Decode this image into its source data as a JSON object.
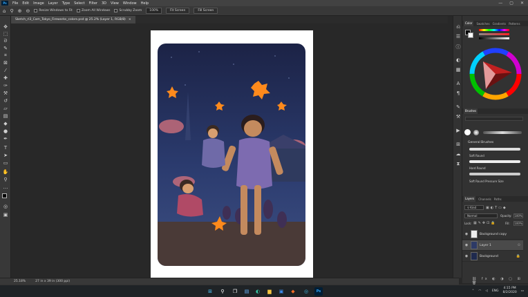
{
  "menubar": {
    "app_badge": "Ps",
    "items": [
      "File",
      "Edit",
      "Image",
      "Layer",
      "Type",
      "Select",
      "Filter",
      "3D",
      "View",
      "Window",
      "Help"
    ]
  },
  "options_bar": {
    "resize_windows_label": "Resize Windows to Fit",
    "zoom_all_label": "Zoom All Windows",
    "scrubby_zoom_label": "Scrubby Zoom",
    "zoom_value": "100%",
    "fit_screen_label": "Fit Screen",
    "fill_screen_label": "Fill Screen"
  },
  "document": {
    "tab_title": "Sketch_rl3_Cam_Tokyo_Fireworks_colors.psd @ 25.2% (Layer 1, RGB/8)",
    "close_glyph": "×"
  },
  "status_bar": {
    "zoom": "25.18%",
    "doc_size": "27 in x 39 in (300 ppi)"
  },
  "panels": {
    "color_tabs": [
      "Color",
      "Swatches",
      "Gradients",
      "Patterns"
    ],
    "brushes_tab": "Brushes",
    "brushes_group": "General Brushes",
    "brushes": [
      "Soft Round",
      "Hard Round",
      "Soft Round Pressure Size"
    ],
    "layers_tabs": [
      "Layers",
      "Channels",
      "Paths"
    ],
    "filter_kind": "Kind",
    "blend_mode": "Normal",
    "opacity_label": "Opacity:",
    "opacity_value": "100%",
    "lock_label": "Lock:",
    "fill_label": "Fill:",
    "fill_value": "100%",
    "layers": [
      {
        "name": "Background copy",
        "selected": false
      },
      {
        "name": "Layer 1",
        "selected": true
      },
      {
        "name": "Background",
        "selected": false
      }
    ]
  },
  "taskbar": {
    "lang": "ENG",
    "time": "4:15 PM",
    "date": "8/2/2020"
  },
  "colors": {
    "ps_blue": "#31a8ff",
    "panel_bg": "#323232",
    "foreground": "#000000",
    "background": "#ffffff"
  }
}
